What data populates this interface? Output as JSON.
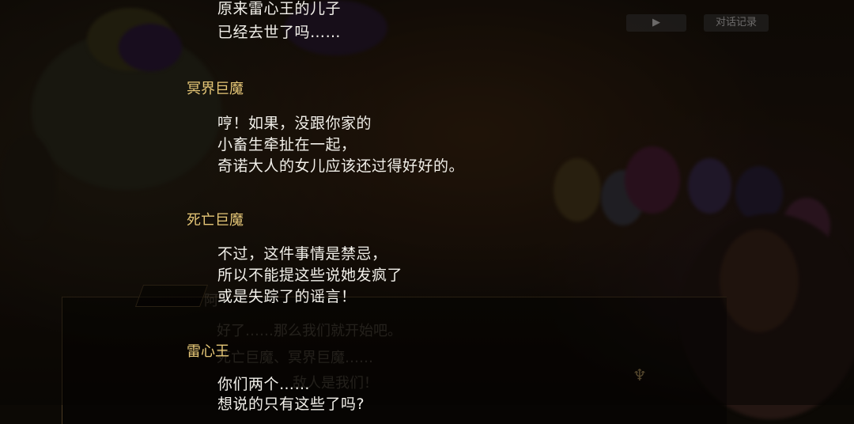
{
  "controls": {
    "autoplay_icon": "play-icon",
    "log_label": "对话记录"
  },
  "background_text": {
    "line1": "好了……那么我们就开始吧。",
    "line2": "死亡巨魔、冥界巨魔……",
    "line3": "敌人是我们！",
    "tab_fragment": "阿"
  },
  "dialogue": [
    {
      "speaker": "",
      "lines": [
        "原来雷心王的儿子",
        "已经去世了吗……"
      ]
    },
    {
      "speaker": "冥界巨魔",
      "lines": [
        "哼！如果，没跟你家的",
        "小畜生牵扯在一起，",
        "奇诺大人的女儿应该还过得好好的。"
      ]
    },
    {
      "speaker": "死亡巨魔",
      "lines": [
        "不过，这件事情是禁忌，",
        "所以不能提这些说她发疯了",
        "或是失踪了的谣言！"
      ]
    },
    {
      "speaker": "雷心王",
      "lines": [
        "你们两个……",
        "想说的只有这些了吗?"
      ]
    }
  ]
}
